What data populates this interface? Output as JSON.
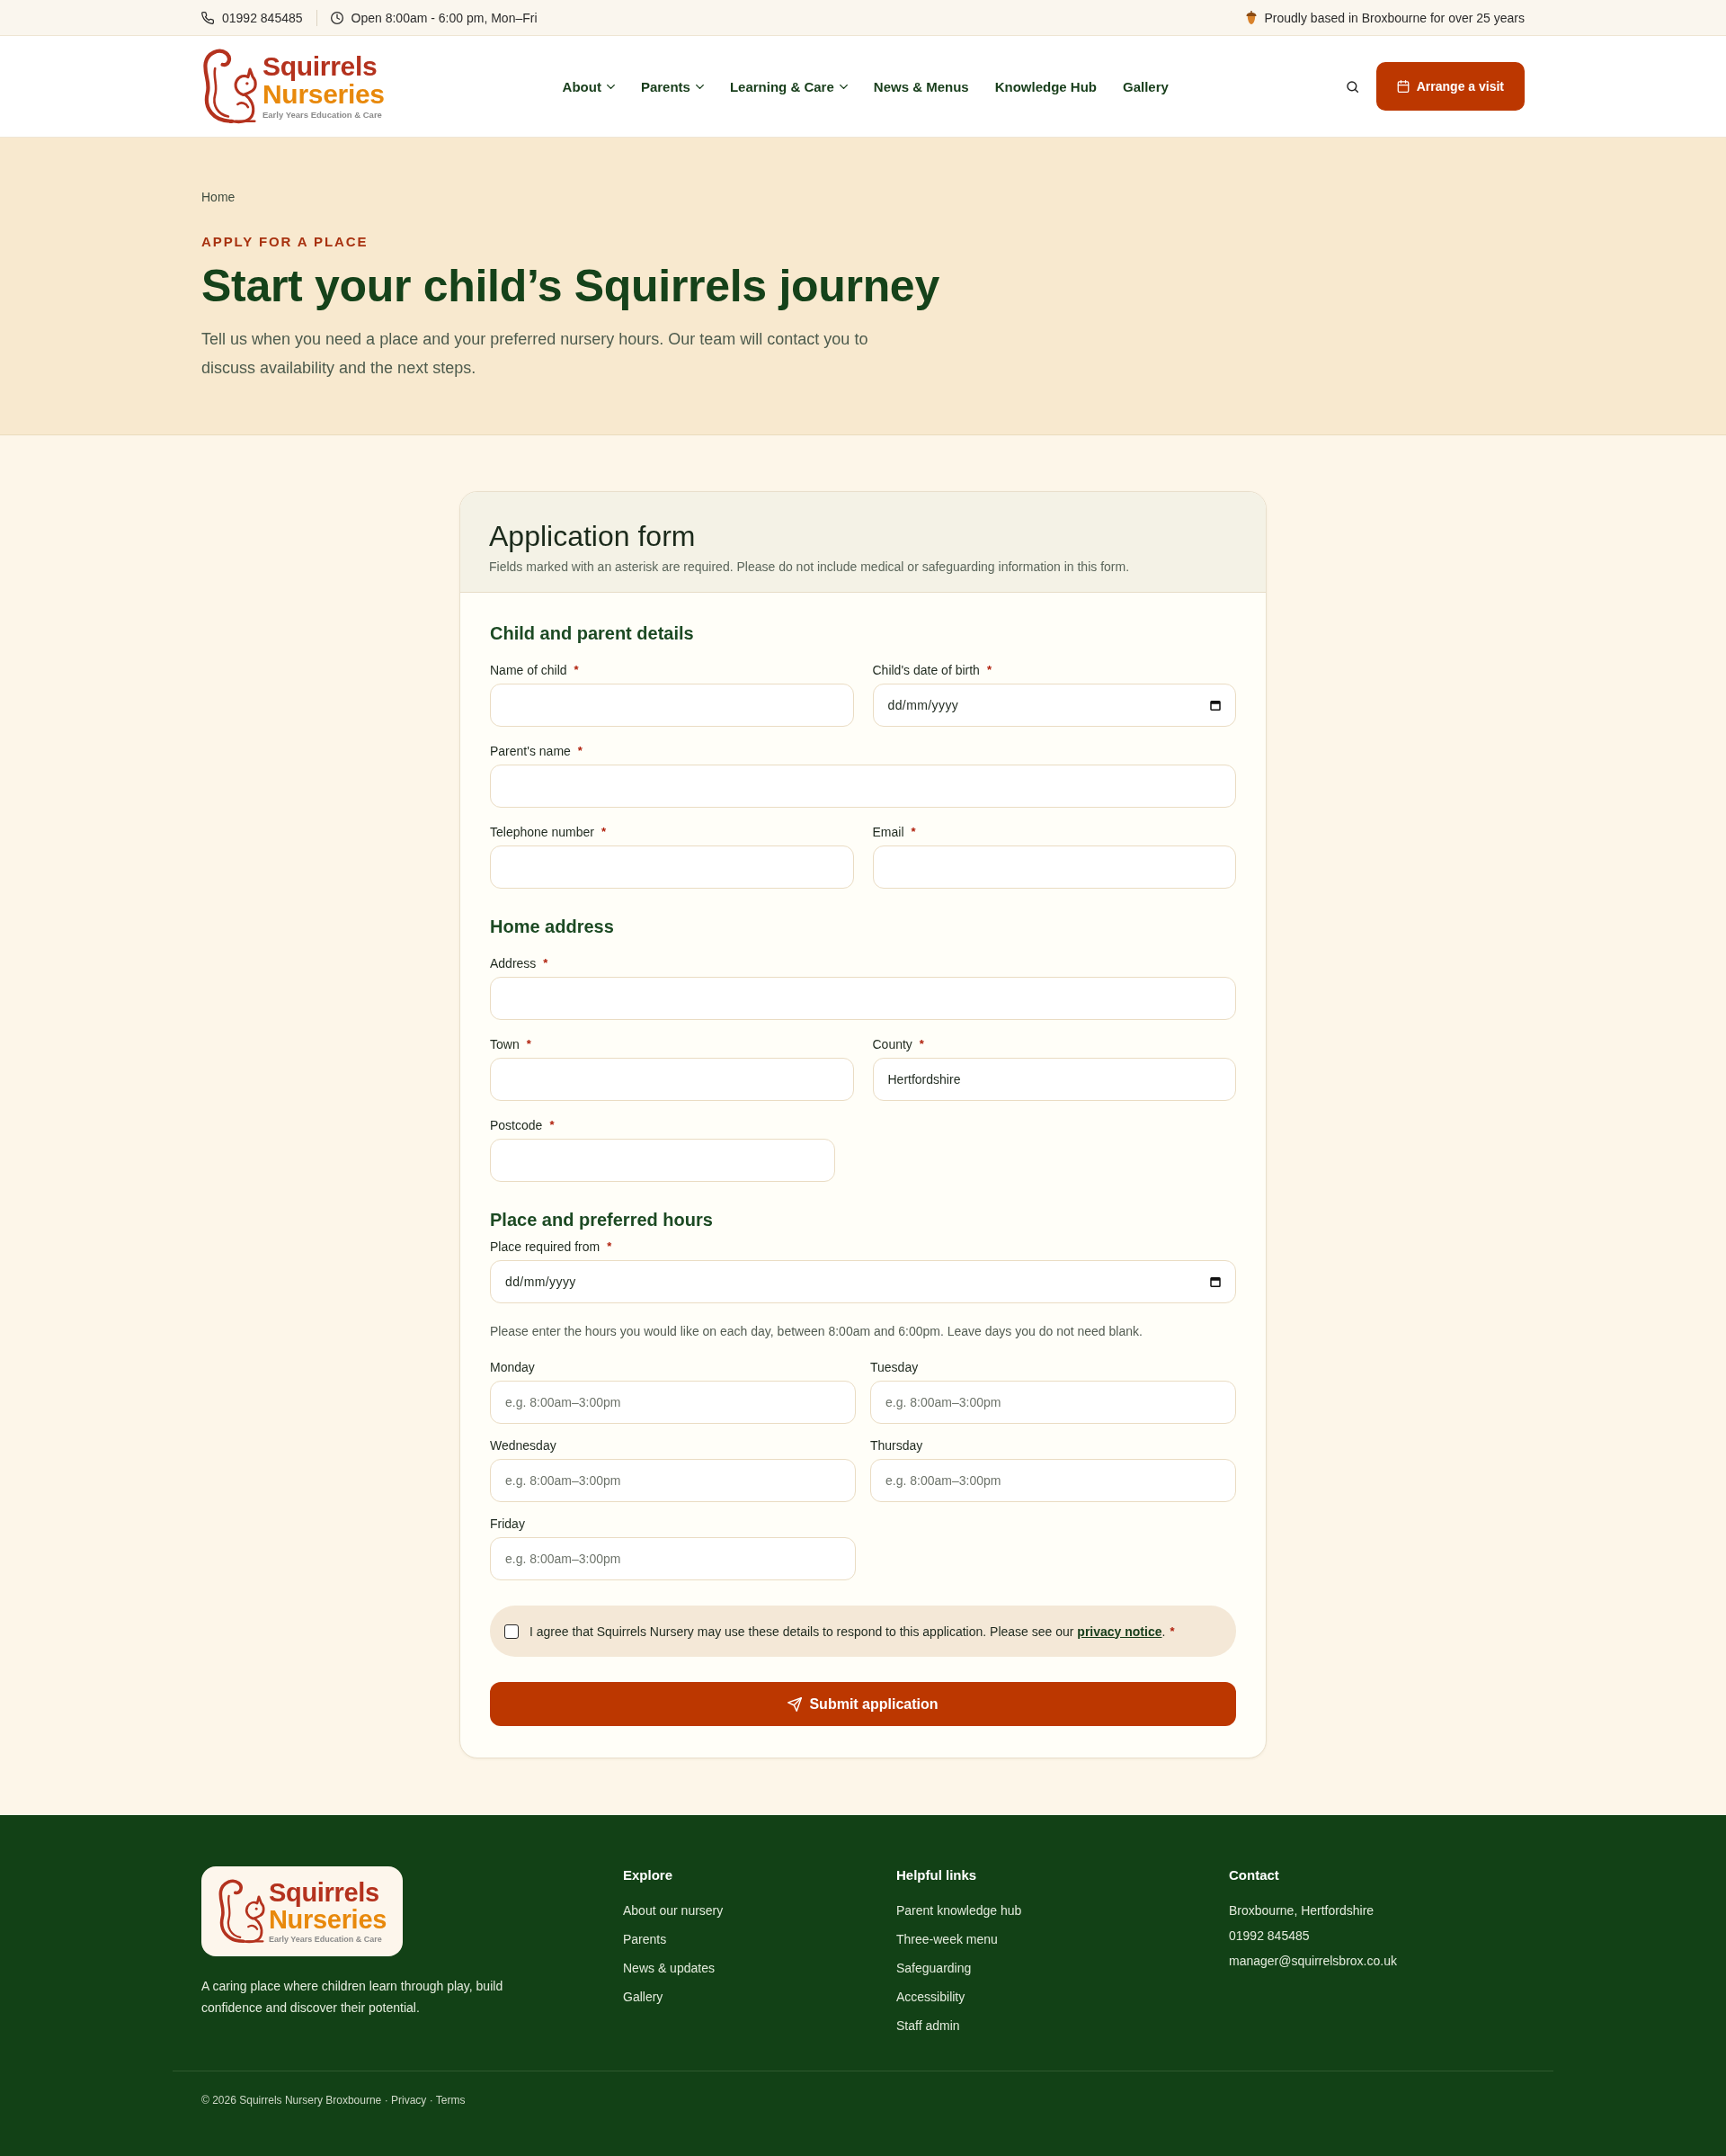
{
  "top_bar": {
    "phone": "01992 845485",
    "hours": "Open 8:00am - 6:00 pm, Mon–Fri",
    "tagline": "Proudly based in Broxbourne for over 25 years"
  },
  "header": {
    "logo": {
      "name": "Squirrels",
      "name_2": "Nurseries",
      "subtitle": "Early Years Education & Care"
    },
    "nav": [
      {
        "label": "About",
        "has_menu": true
      },
      {
        "label": "Parents",
        "has_menu": true
      },
      {
        "label": "Learning & Care",
        "has_menu": true
      },
      {
        "label": "News & Menus",
        "has_menu": false
      },
      {
        "label": "Knowledge Hub",
        "has_menu": false
      },
      {
        "label": "Gallery",
        "has_menu": false
      }
    ],
    "cta": "Arrange a visit"
  },
  "hero": {
    "breadcrumb": "Home",
    "eyebrow": "APPLY FOR A PLACE",
    "title": "Start your child’s Squirrels journey",
    "intro": "Tell us when you need a place and your preferred nursery hours. Our team will contact you to discuss availability and the next steps."
  },
  "form": {
    "title": "Application form",
    "note": "Fields marked with an asterisk are required. Please do not include medical or safeguarding information in this form.",
    "sections": [
      {
        "title": "Child and parent details",
        "rows": [
          [
            {
              "label": "Name of child",
              "required_mark": "*",
              "kind": "text"
            },
            {
              "label": "Child's date of birth",
              "required_mark": "*",
              "kind": "date",
              "placeholder": "dd/mm/yyyy"
            }
          ],
          [
            {
              "label": "Parent's name",
              "required_mark": "*",
              "kind": "text"
            }
          ],
          [
            {
              "label": "Telephone number",
              "required_mark": "*",
              "kind": "text"
            },
            {
              "label": "Email",
              "required_mark": "*",
              "kind": "text"
            }
          ]
        ]
      },
      {
        "title": "Home address",
        "rows": [
          [
            {
              "label": "Address",
              "required_mark": "*",
              "kind": "text"
            }
          ],
          [
            {
              "label": "Town",
              "required_mark": "*",
              "kind": "text"
            },
            {
              "label": "County",
              "required_mark": "*",
              "kind": "text",
              "value": "Hertfordshire"
            }
          ],
          [
            {
              "label": "Postcode",
              "required_mark": "*",
              "kind": "short"
            }
          ]
        ]
      },
      {
        "title": "Place and preferred hours",
        "rows": [
          [
            {
              "label": "Place required from",
              "required_mark": "*",
              "kind": "date",
              "placeholder": "dd/mm/yyyy"
            }
          ]
        ],
        "hint": "Please enter the hours you would like on each day, between 8:00am and 6:00pm. Leave days you do not need blank.",
        "days": [
          {
            "label": "Monday",
            "kind": "text",
            "placeholder": "e.g. 8:00am–3:00pm"
          },
          {
            "label": "Tuesday",
            "kind": "text",
            "placeholder": "e.g. 8:00am–3:00pm"
          },
          {
            "label": "Wednesday",
            "kind": "text",
            "placeholder": "e.g. 8:00am–3:00pm"
          },
          {
            "label": "Thursday",
            "kind": "text",
            "placeholder": "e.g. 8:00am–3:00pm"
          },
          {
            "label": "Friday",
            "kind": "text",
            "placeholder": "e.g. 8:00am–3:00pm"
          }
        ]
      }
    ],
    "consent": {
      "checked": false,
      "text": "I agree that Squirrels Nursery may use these details to respond to this application. Please see our",
      "link": "privacy notice",
      "after_link": ".",
      "required_mark": "*"
    },
    "submit": "Submit application"
  },
  "footer": {
    "logo": {
      "name": "Squirrels",
      "name_2": "Nurseries",
      "subtitle": "Early Years Education & Care"
    },
    "description": "A caring place where children learn through play, build confidence and discover their potential.",
    "columns": [
      {
        "title": "Explore",
        "kind": "links",
        "items": [
          "About our nursery",
          "Parents",
          "News & updates",
          "Gallery"
        ]
      },
      {
        "title": "Helpful links",
        "kind": "links",
        "items": [
          "Parent knowledge hub",
          "Three-week menu",
          "Safeguarding",
          "Accessibility",
          "Staff admin"
        ]
      },
      {
        "title": "Contact",
        "kind": "contact",
        "items": [
          "Broxbourne, Hertfordshire",
          "01992 845485",
          "manager@squirrelsbrox.co.uk"
        ]
      }
    ],
    "legal": {
      "copyright": "© 2026 Squirrels Nursery Broxbourne",
      "separator": "·",
      "links": [
        "Privacy",
        "Terms"
      ]
    }
  }
}
